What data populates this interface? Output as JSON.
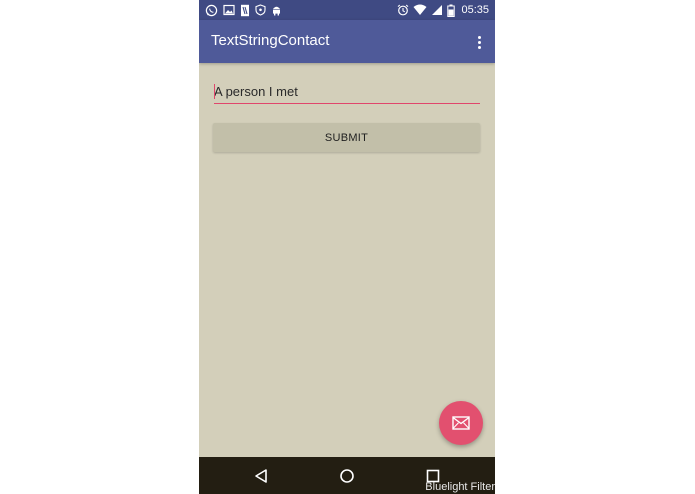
{
  "status_bar": {
    "time": "05:35",
    "left_icons": [
      "whatsapp-icon",
      "gallery-icon",
      "document-icon",
      "shield-icon",
      "android-icon"
    ],
    "right_icons": [
      "alarm-icon",
      "wifi-icon",
      "signal-icon",
      "battery-icon"
    ]
  },
  "toolbar": {
    "title": "TextStringContact",
    "menu_icon": "more-vert-icon"
  },
  "form": {
    "input_value": "A person I met",
    "submit_label": "SUBMIT"
  },
  "fab": {
    "icon": "email-icon"
  },
  "nav_bar": {
    "icons": [
      "back-icon",
      "home-icon",
      "recents-icon"
    ],
    "overlay_label": "Bluelight Filter"
  },
  "colors": {
    "status_bar": "#3f4a83",
    "toolbar": "#4f5a99",
    "background": "#d3cfba",
    "accent": "#e2506f",
    "button": "#c2bfa9",
    "nav_bar": "#231e12"
  }
}
